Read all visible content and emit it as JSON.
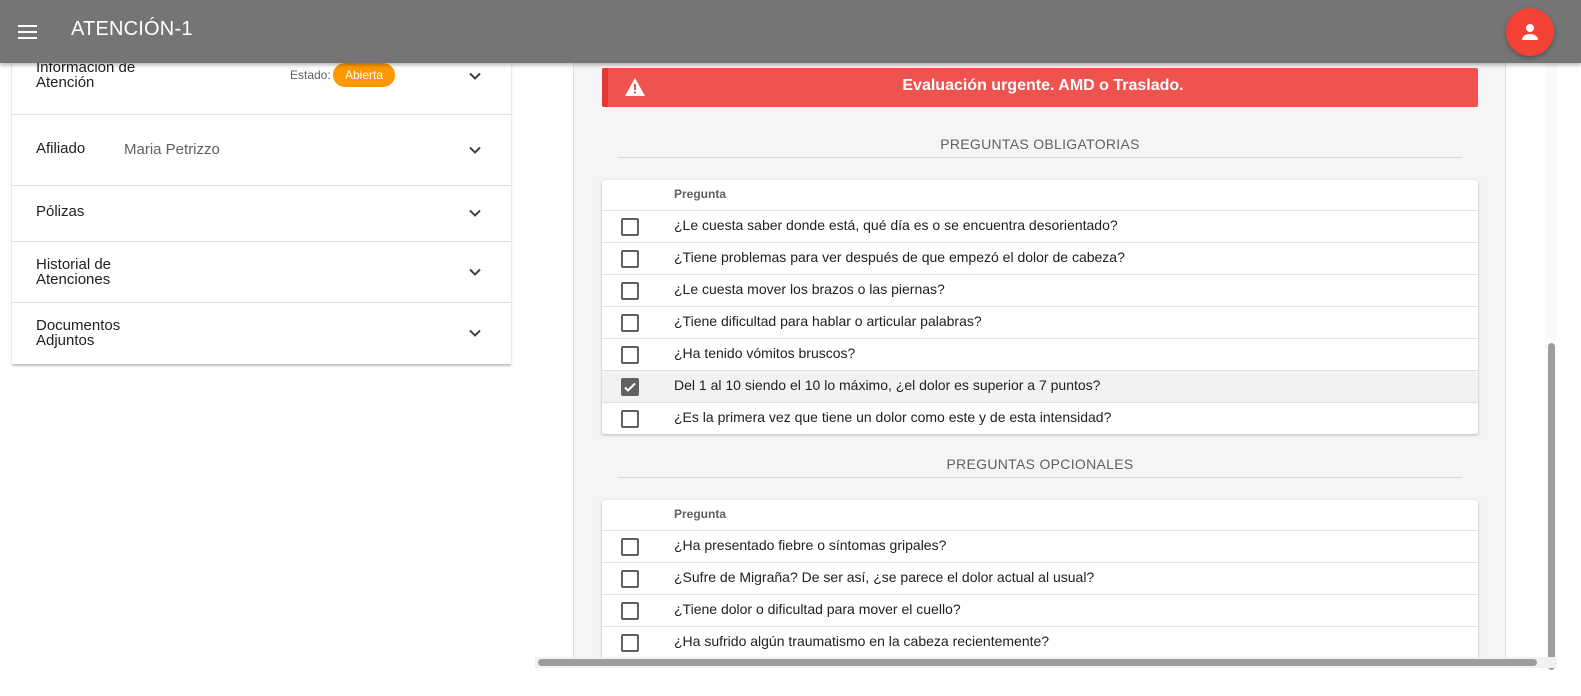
{
  "appbar": {
    "title": "ATENCIÓN-1",
    "menu_icon": "menu-icon",
    "avatar_icon": "person-icon",
    "background": "#757575"
  },
  "sidebar": {
    "info": {
      "label": "Información de Atención",
      "estado_label": "Estado:",
      "estado_value": "Abierta",
      "badge_color": "#ff9800"
    },
    "afiliado": {
      "label": "Afiliado",
      "value": "Maria Petrizzo"
    },
    "polizas": {
      "label": "Pólizas"
    },
    "historial": {
      "label": "Historial de Atenciones"
    },
    "documentos": {
      "label": "Documentos Adjuntos"
    }
  },
  "alert": {
    "text": "Evaluación urgente. AMD o Traslado.",
    "icon": "warning-icon",
    "color": "#ef5350"
  },
  "obligatorias": {
    "title": "PREGUNTAS OBLIGATORIAS",
    "column_header": "Pregunta",
    "rows": [
      {
        "text": "¿Le cuesta saber donde está, qué día es o se encuentra desorientado?",
        "checked": false
      },
      {
        "text": "¿Tiene problemas para ver después de que empezó el dolor de cabeza?",
        "checked": false
      },
      {
        "text": "¿Le cuesta mover los brazos o las piernas?",
        "checked": false
      },
      {
        "text": "¿Tiene dificultad para hablar o articular palabras?",
        "checked": false
      },
      {
        "text": "¿Ha tenido vómitos bruscos?",
        "checked": false
      },
      {
        "text": "Del 1 al 10 siendo el 10 lo máximo, ¿el dolor es superior a 7 puntos?",
        "checked": true
      },
      {
        "text": "¿Es la primera vez que tiene un dolor como este y de esta intensidad?",
        "checked": false
      }
    ]
  },
  "opcionales": {
    "title": "PREGUNTAS OPCIONALES",
    "column_header": "Pregunta",
    "rows": [
      {
        "text": "¿Ha presentado fiebre o síntomas gripales?",
        "checked": false
      },
      {
        "text": "¿Sufre de Migraña? De ser así, ¿se parece el dolor actual al usual?",
        "checked": false
      },
      {
        "text": "¿Tiene dolor o dificultad para mover el cuello?",
        "checked": false
      },
      {
        "text": "¿Ha sufrido algún traumatismo en la cabeza recientemente?",
        "checked": false
      }
    ]
  }
}
